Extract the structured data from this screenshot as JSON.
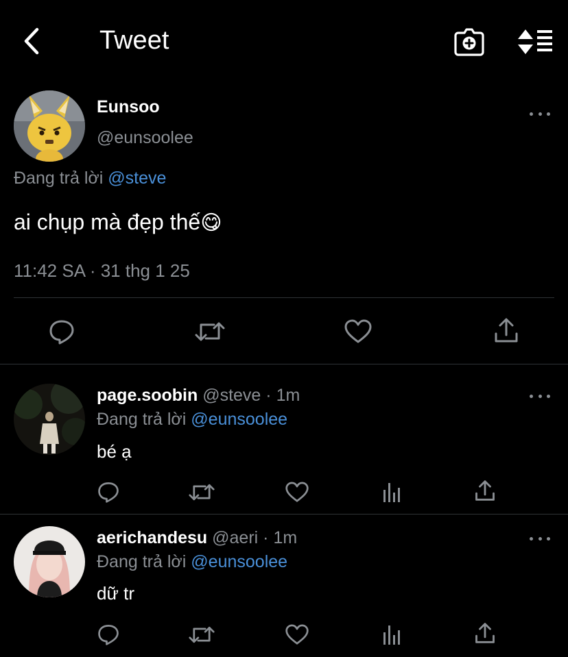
{
  "header": {
    "title": "Tweet"
  },
  "tweet": {
    "name": "Eunsoo",
    "handle": "@eunsoolee",
    "replying_prefix": "Đang trả lời",
    "replying_to": "@steve",
    "text": "ai chụp mà đẹp thế",
    "emoji": "😋",
    "timestamp": "11:42 SA · 31 thg 1 25"
  },
  "replies": [
    {
      "name": "page.soobin",
      "handle": "@steve",
      "sep": "·",
      "time": "1m",
      "replying_prefix": "Đang trả lời",
      "replying_to": "@eunsoolee",
      "text": "bé ạ"
    },
    {
      "name": "aerichandesu",
      "handle": "@aeri",
      "sep": "·",
      "time": "1m",
      "replying_prefix": "Đang trả lời",
      "replying_to": "@eunsoolee",
      "text": "dữ tr"
    }
  ],
  "icons": {
    "back": "chevron-left-icon",
    "camera": "camera-plus-icon",
    "sort": "sort-icon",
    "reply": "reply-icon",
    "retweet": "retweet-icon",
    "like": "heart-icon",
    "share": "share-icon",
    "analytics": "analytics-icon"
  },
  "colors": {
    "background": "#000000",
    "link": "#4a90d9",
    "muted": "#8b8f94"
  }
}
